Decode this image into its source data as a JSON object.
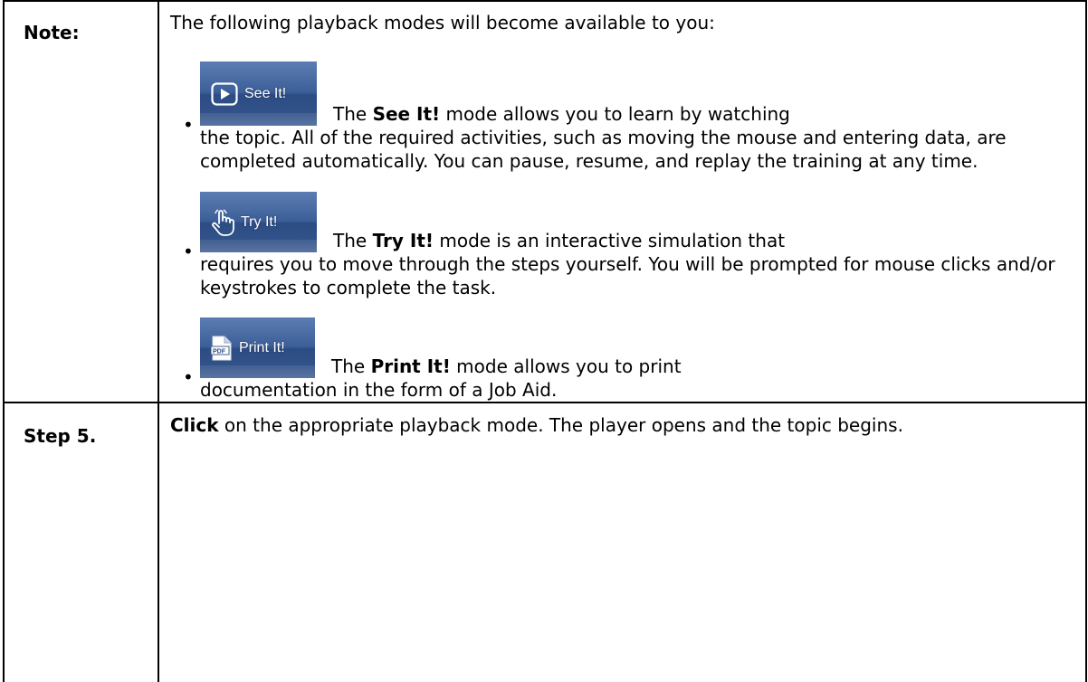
{
  "note": {
    "label": "Note:",
    "intro": "The following playback modes will become available to you:",
    "modes": [
      {
        "button_label": "See It!",
        "icon": "play-icon",
        "desc_pre": "The ",
        "desc_bold": "See It!",
        "desc_first_line": " mode allows you to learn by watching",
        "desc_rest": "the topic. All of the required activities, such as moving the mouse and entering data, are completed automatically. You can pause, resume, and replay the training at any time."
      },
      {
        "button_label": "Try It!",
        "icon": "hand-pointer-icon",
        "desc_pre": "The ",
        "desc_bold": "Try It!",
        "desc_first_line": " mode is an interactive simulation that",
        "desc_rest": "requires you to move through the steps yourself. You will be prompted for mouse clicks and/or keystrokes to complete the task."
      },
      {
        "button_label": "Print It!",
        "icon": "pdf-document-icon",
        "desc_pre": "The ",
        "desc_bold": "Print It!",
        "desc_first_line": " mode allows you to print",
        "desc_rest": "documentation in the form of a Job Aid."
      }
    ]
  },
  "step": {
    "label": "Step 5.",
    "bold": "Click",
    "text": " on the appropriate playback mode. The player opens and the topic begins."
  },
  "colors": {
    "button_top": "#5b7db3",
    "button_bottom": "#2c4c84",
    "border": "#000000"
  }
}
